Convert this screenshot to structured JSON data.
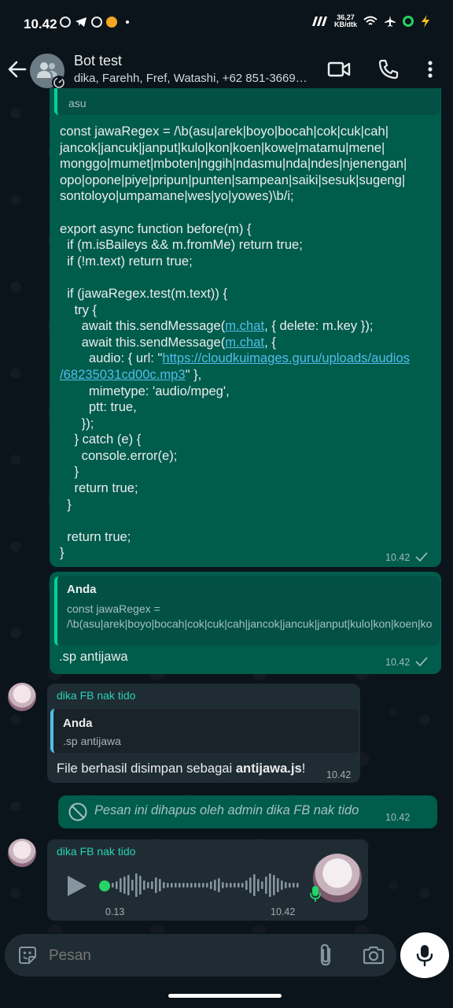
{
  "status_bar": {
    "time": "10.42",
    "network_speed_value": "36,27",
    "network_speed_unit": "KB/dtk"
  },
  "header": {
    "title": "Bot test",
    "subtitle": "dika, Farehh, Fref, Watashi, +62 851-3669…",
    "icons": [
      "back-arrow-icon",
      "group-avatar-icon",
      "video-call-icon",
      "voice-call-icon",
      "more-options-icon"
    ]
  },
  "messages": {
    "code_message": {
      "quote_tail": "asu",
      "code": "const jawaRegex = /\\b(asu|arek|boyo|bocah|cok|cuk|cah|\njancok|jancuk|janput|kulo|kon|koen|kowe|matamu|mene|\nmonggo|mumet|mboten|nggih|ndasmu|nda|ndes|njenengan|\nopo|opone|piye|pripun|punten|sampean|saiki|sesuk|sugeng|\nsontoloyo|umpamane|wes|yo|yowes)\\b/i;\n\nexport async function before(m) {\n  if (m.isBaileys && m.fromMe) return true;\n  if (!m.text) return true;\n\n  if (jawaRegex.test(m.text)) {\n    try {\n      await this.sendMessage(",
      "link1": "m.chat",
      "code2": ", { delete: m.key });\n      await this.sendMessage(",
      "link2": "m.chat",
      "code3": ", {\n        audio: { url: \"",
      "link3": "https://cloudkuimages.guru/uploads/audios\n/68235031cd00c.mp3",
      "code4": "\" },\n        mimetype: 'audio/mpeg',\n        ptt: true,\n      });\n    } catch (e) {\n      console.error(e);\n    }\n    return true;\n  }\n\n  return true;\n}",
      "time": "10.42"
    },
    "sp_message": {
      "quote_author": "Anda",
      "quote_text": "const jawaRegex = /\\b(asu|arek|boyo|bocah|cok|cuk|cah|jancok|jancuk|janput|kulo|kon|koen|kowe|matamu|mene|monggo|mumet|mboten|nggih|ndasmu|nda|ndes|njenengan|opo|opone|piye|pripu...",
      "text": ".sp antijawa",
      "time": "10.42"
    },
    "reply_message": {
      "sender": "dika FB nak tido",
      "quote_author": "Anda",
      "quote_text": ".sp antijawa",
      "text_prefix": "File berhasil disimpan sebagai ",
      "text_bold": "antijawa.js",
      "text_suffix": "!",
      "time": "10.42"
    },
    "deleted_message": {
      "text": "Pesan ini dihapus oleh admin dika FB nak tido",
      "time": "10.42"
    },
    "voice_message": {
      "sender": "dika FB nak tido",
      "elapsed": "0.13",
      "time": "10.42",
      "progress": 0.0
    }
  },
  "input": {
    "placeholder": "Pesan"
  },
  "colors": {
    "outgoing_bubble": "#005c4b",
    "incoming_bubble": "#202c33",
    "background": "#0b141a",
    "link": "#53bdeb",
    "sender_name": "#25d3b5"
  }
}
